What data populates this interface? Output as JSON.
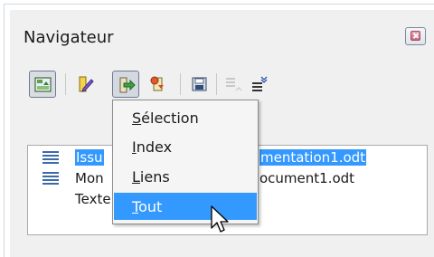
{
  "panel": {
    "title": "Navigateur"
  },
  "toolbar": {
    "buttons": [
      {
        "icon": "navigator-toggle-icon",
        "state": "toggled"
      },
      {
        "icon": "edit-pencil-icon",
        "state": "normal"
      },
      {
        "icon": "navigation-arrow-icon",
        "state": "pressed"
      },
      {
        "icon": "insert-document-icon",
        "state": "normal"
      },
      {
        "icon": "save-document-icon",
        "state": "normal"
      },
      {
        "icon": "promote-level-icon",
        "state": "disabled"
      },
      {
        "icon": "demote-level-icon",
        "state": "normal"
      }
    ]
  },
  "menu": {
    "items": [
      {
        "label": "Sélection",
        "mnemonic": "S",
        "highlighted": false
      },
      {
        "label": "Index",
        "mnemonic": "I",
        "highlighted": false
      },
      {
        "label": "Liens",
        "mnemonic": "L",
        "highlighted": false
      },
      {
        "label": "Tout",
        "mnemonic": "T",
        "highlighted": true
      }
    ]
  },
  "tree": {
    "rows": [
      {
        "left_text": "Issu",
        "right_text": "mentation1.odt",
        "selected": true
      },
      {
        "left_text": "Mon",
        "right_text": "ocument1.odt",
        "selected": false
      },
      {
        "left_text": "Texte",
        "right_text": "",
        "selected": false
      }
    ]
  },
  "colors": {
    "selection": "#3399ff",
    "panel_background": "#f0f0f0",
    "menu_background": "#f5f5f5"
  }
}
